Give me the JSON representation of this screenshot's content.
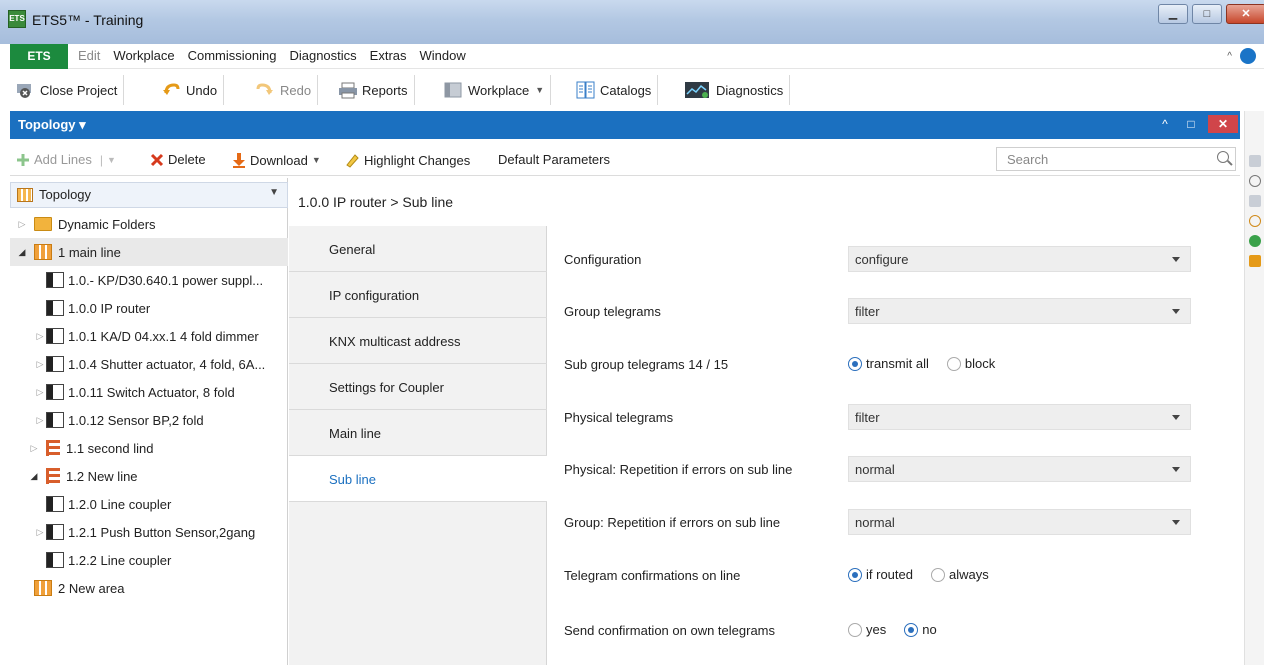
{
  "window": {
    "title": "ETS5™ - Training",
    "app_icon_text": "ETS",
    "min_symbol": "▁",
    "max_symbol": "□",
    "close_symbol": "✕"
  },
  "menu": {
    "ets_label": "ETS",
    "items": [
      "Edit",
      "Workplace",
      "Commissioning",
      "Diagnostics",
      "Extras",
      "Window"
    ],
    "caret": "^"
  },
  "toolbar": {
    "close_project": "Close Project",
    "undo": "Undo",
    "redo": "Redo",
    "reports": "Reports",
    "workplace": "Workplace",
    "catalogs": "Catalogs",
    "diagnostics": "Diagnostics"
  },
  "panel": {
    "title": "Topology",
    "up_symbol": "^",
    "restore_symbol": "□",
    "close_symbol": "✕"
  },
  "commands": {
    "add_lines": "Add Lines",
    "delete": "Delete",
    "download": "Download",
    "highlight_changes": "Highlight Changes",
    "default_parameters": "Default Parameters",
    "search_placeholder": "Search"
  },
  "tree": {
    "header": "Topology",
    "rows": [
      {
        "label": "Dynamic Folders"
      },
      {
        "label": "1 main line"
      },
      {
        "label": "1.0.- KP/D30.640.1 power suppl..."
      },
      {
        "label": "1.0.0 IP router"
      },
      {
        "label": "1.0.1 KA/D 04.xx.1 4 fold dimmer"
      },
      {
        "label": "1.0.4 Shutter actuator, 4 fold, 6A..."
      },
      {
        "label": "1.0.11 Switch Actuator, 8 fold"
      },
      {
        "label": "1.0.12 Sensor BP,2 fold"
      },
      {
        "label": "1.1 second lind"
      },
      {
        "label": "1.2 New line"
      },
      {
        "label": "1.2.0 Line coupler"
      },
      {
        "label": "1.2.1 Push Button Sensor,2gang"
      },
      {
        "label": "1.2.2 Line coupler"
      },
      {
        "label": "2 New area"
      }
    ]
  },
  "breadcrumb": "1.0.0 IP router > Sub line",
  "tabs": [
    "General",
    "IP configuration",
    "KNX multicast address",
    "Settings for Coupler",
    "Main line",
    "Sub line"
  ],
  "params": {
    "configuration": {
      "label": "Configuration",
      "value": "configure"
    },
    "group_telegrams": {
      "label": "Group telegrams",
      "value": "filter"
    },
    "sub_group": {
      "label": "Sub group telegrams 14 / 15",
      "opt1": "transmit all",
      "opt2": "block"
    },
    "physical_telegrams": {
      "label": "Physical telegrams",
      "value": "filter"
    },
    "physical_repetition": {
      "label": "Physical: Repetition if errors on sub line",
      "value": "normal"
    },
    "group_repetition": {
      "label": "Group: Repetition if errors on sub line",
      "value": "normal"
    },
    "telegram_confirmations": {
      "label": "Telegram confirmations on line",
      "opt1": "if routed",
      "opt2": "always"
    },
    "send_confirmation": {
      "label": "Send confirmation on own telegrams",
      "opt1": "yes",
      "opt2": "no"
    }
  }
}
